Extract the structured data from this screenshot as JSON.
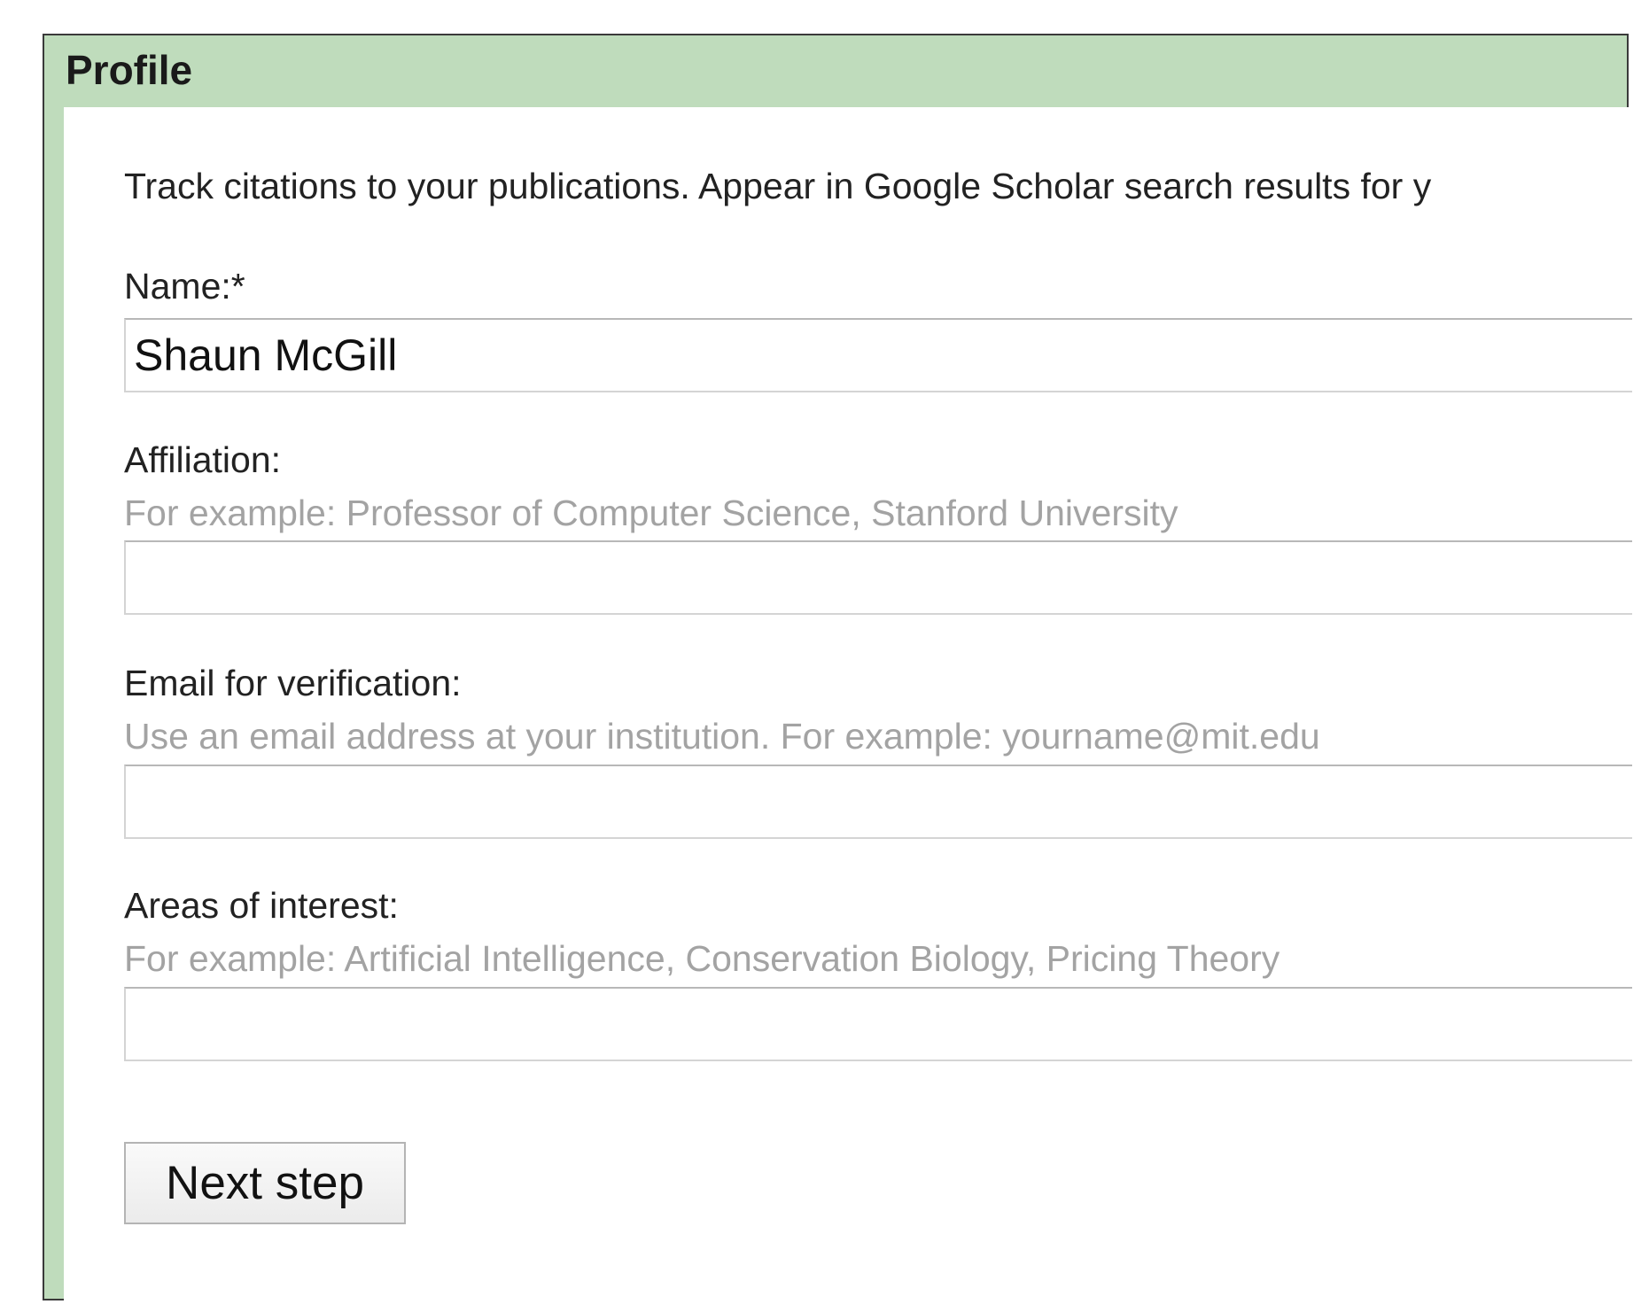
{
  "panel": {
    "title": "Profile"
  },
  "intro_text": "Track citations to your publications. Appear in Google Scholar search results for y",
  "form": {
    "name": {
      "label": "Name:*",
      "value": "Shaun McGill"
    },
    "affiliation": {
      "label": "Affiliation:",
      "hint": "For example: Professor of Computer Science, Stanford University",
      "value": ""
    },
    "email": {
      "label": "Email for verification:",
      "hint": "Use an email address at your institution. For example: yourname@mit.edu",
      "value": ""
    },
    "interests": {
      "label": "Areas of interest:",
      "hint": "For example: Artificial Intelligence, Conservation Biology, Pricing Theory",
      "value": ""
    },
    "next_button_label": "Next step"
  },
  "colors": {
    "header_bg": "#bfdcbc",
    "hint_text": "#a3a3a3",
    "border": "#3a3a3a"
  }
}
